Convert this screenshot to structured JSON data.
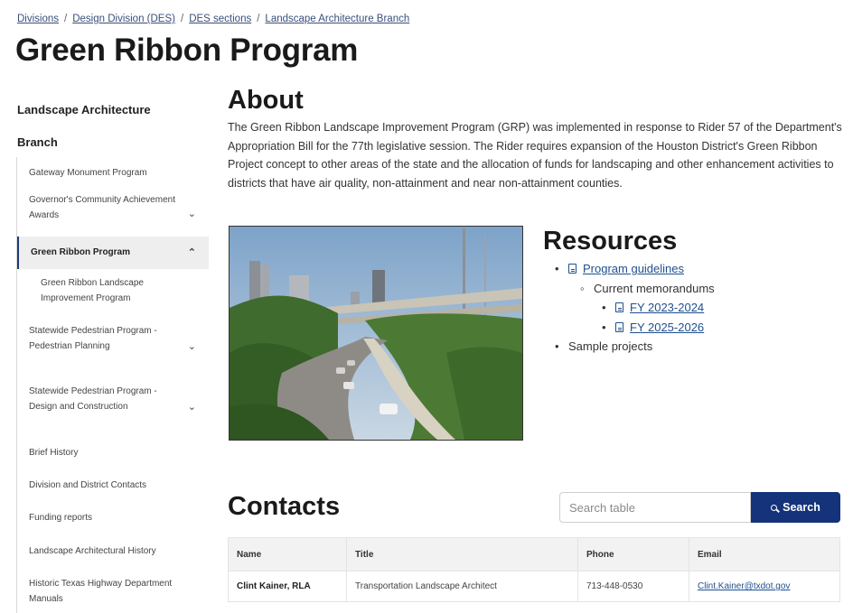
{
  "breadcrumb": [
    {
      "label": "Divisions"
    },
    {
      "label": "Design Division (DES)"
    },
    {
      "label": "DES sections"
    },
    {
      "label": "Landscape Architecture Branch"
    }
  ],
  "page_title": "Green Ribbon Program",
  "sidebar": {
    "heading_line1": "Landscape Architecture",
    "heading_line2": "Branch",
    "items": [
      {
        "label": "Gateway Monument Program"
      },
      {
        "label": "Governor's Community Achievement Awards",
        "chevron": "⌄"
      },
      {
        "label": "Green Ribbon Program",
        "chevron": "⌃"
      },
      {
        "label": "Green Ribbon Landscape Improvement Program"
      },
      {
        "label": "Statewide Pedestrian Program - Pedestrian Planning",
        "chevron": "⌄"
      },
      {
        "label": "Statewide Pedestrian Program - Design and Construction",
        "chevron": "⌄"
      },
      {
        "label": "Brief History"
      },
      {
        "label": "Division and District Contacts"
      },
      {
        "label": "Funding reports"
      },
      {
        "label": "Landscape Architectural History"
      },
      {
        "label": "Historic Texas Highway Department Manuals"
      }
    ]
  },
  "about": {
    "title": "About",
    "text": "The Green Ribbon Landscape Improvement Program (GRP) was implemented in response to Rider 57 of the Department's Appropriation Bill for the 77th legislative session. The Rider requires expansion of the Houston District's Green Ribbon Project concept to other areas of the state and the allocation of funds for landscaping and other enhancement activities to districts that have air quality, non-attainment and near non-attainment counties."
  },
  "resources": {
    "title": "Resources",
    "program_guidelines": "Program guidelines",
    "current_memorandums": "Current memorandums",
    "fy1": "FY 2023-2024",
    "fy2": "FY 2025-2026",
    "sample_projects": "Sample projects"
  },
  "contacts": {
    "title": "Contacts",
    "search_placeholder": "Search table",
    "search_button": "Search",
    "columns": [
      "Name",
      "Title",
      "Phone",
      "Email"
    ],
    "rows": [
      {
        "name": "Clint Kainer, RLA",
        "title": "Transportation Landscape Architect",
        "phone": "713-448-0530",
        "email": "Clint.Kainer@txdot.gov"
      }
    ]
  },
  "colors": {
    "accent": "#14337a",
    "link": "#1f4f8f"
  }
}
